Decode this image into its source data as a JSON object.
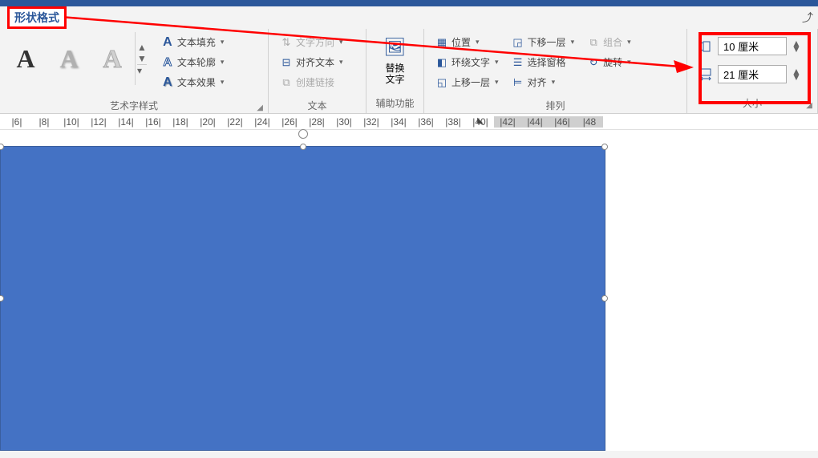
{
  "tab": {
    "shape_format": "形状格式"
  },
  "wordart": {
    "group_label": "艺术字样式",
    "text_fill": "文本填充",
    "text_outline": "文本轮廓",
    "text_effects": "文本效果"
  },
  "text": {
    "group_label": "文本",
    "text_direction": "文字方向",
    "align_text": "对齐文本",
    "create_link": "创建链接"
  },
  "accessibility": {
    "group_label": "辅助功能",
    "alt_text": "替换\n文字"
  },
  "arrange": {
    "group_label": "排列",
    "position": "位置",
    "wrap_text": "环绕文字",
    "bring_forward": "上移一层",
    "send_backward": "下移一层",
    "selection_pane": "选择窗格",
    "align": "对齐",
    "group": "组合",
    "rotate": "旋转"
  },
  "size": {
    "group_label": "大小",
    "height": "10 厘米",
    "width": "21 厘米"
  },
  "ruler": {
    "marks": [
      "|6|",
      "|8|",
      "|10|",
      "|12|",
      "|14|",
      "|16|",
      "|18|",
      "|20|",
      "|22|",
      "|24|",
      "|26|",
      "|28|",
      "|30|",
      "|32|",
      "|34|",
      "|36|",
      "|38|",
      "|40|",
      "|42|",
      "|44|",
      "|46|",
      "|48"
    ]
  }
}
